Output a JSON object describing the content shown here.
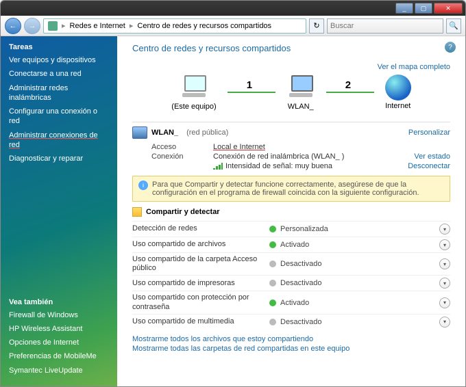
{
  "titlebar": {
    "min": "_",
    "max": "▢",
    "close": "✕"
  },
  "nav": {
    "back": "←",
    "forward": "→",
    "crumb1": "Redes e Internet",
    "crumb2": "Centro de redes y recursos compartidos",
    "sep": "▸",
    "refresh": "↻",
    "search_placeholder": "Buscar",
    "search_icon": "🔍"
  },
  "sidebar": {
    "header": "Tareas",
    "items": [
      "Ver equipos y dispositivos",
      "Conectarse a una red",
      "Administrar redes inalámbricas",
      "Configurar una conexión o red",
      "Administrar conexiones de red",
      "Diagnosticar y reparar"
    ],
    "also_header": "Vea también",
    "also": [
      "Firewall de Windows",
      "HP Wireless Assistant",
      "Opciones de Internet",
      "Preferencias de MobileMe",
      "Symantec LiveUpdate"
    ]
  },
  "main": {
    "title": "Centro de redes y recursos compartidos",
    "help": "?",
    "map_link": "Ver el mapa completo",
    "diagram": {
      "pc_label": "(Este equipo)",
      "link1": "1",
      "wlan_label": "WLAN_",
      "link2": "2",
      "internet_label": "Internet"
    },
    "network": {
      "name": "WLAN_",
      "type": "(red pública)",
      "customize": "Personalizar",
      "access_k": "Acceso",
      "access_v": "Local e Internet",
      "conn_k": "Conexión",
      "conn_v": "Conexión de red inalámbrica (WLAN_  )",
      "conn_view": "Ver estado",
      "signal_k": "Intensidad de señal: muy buena",
      "disconnect": "Desconectar"
    },
    "info": "Para que Compartir y detectar funcione correctamente, asegúrese de que la configuración en el programa de firewall coincida con la siguiente configuración.",
    "share_title": "Compartir y detectar",
    "rows": [
      {
        "label": "Detección de redes",
        "value": "Personalizada",
        "on": true
      },
      {
        "label": "Uso compartido de archivos",
        "value": "Activado",
        "on": true
      },
      {
        "label": "Uso compartido de la carpeta Acceso público",
        "value": "Desactivado",
        "on": false
      },
      {
        "label": "Uso compartido de impresoras",
        "value": "Desactivado",
        "on": false
      },
      {
        "label": "Uso compartido con protección por contraseña",
        "value": "Activado",
        "on": true
      },
      {
        "label": "Uso compartido de multimedia",
        "value": "Desactivado",
        "on": false
      }
    ],
    "footer": [
      "Mostrarme todos los archivos que estoy compartiendo",
      "Mostrarme todas las carpetas de red compartidas en este equipo"
    ],
    "expand_glyph": "▾"
  }
}
